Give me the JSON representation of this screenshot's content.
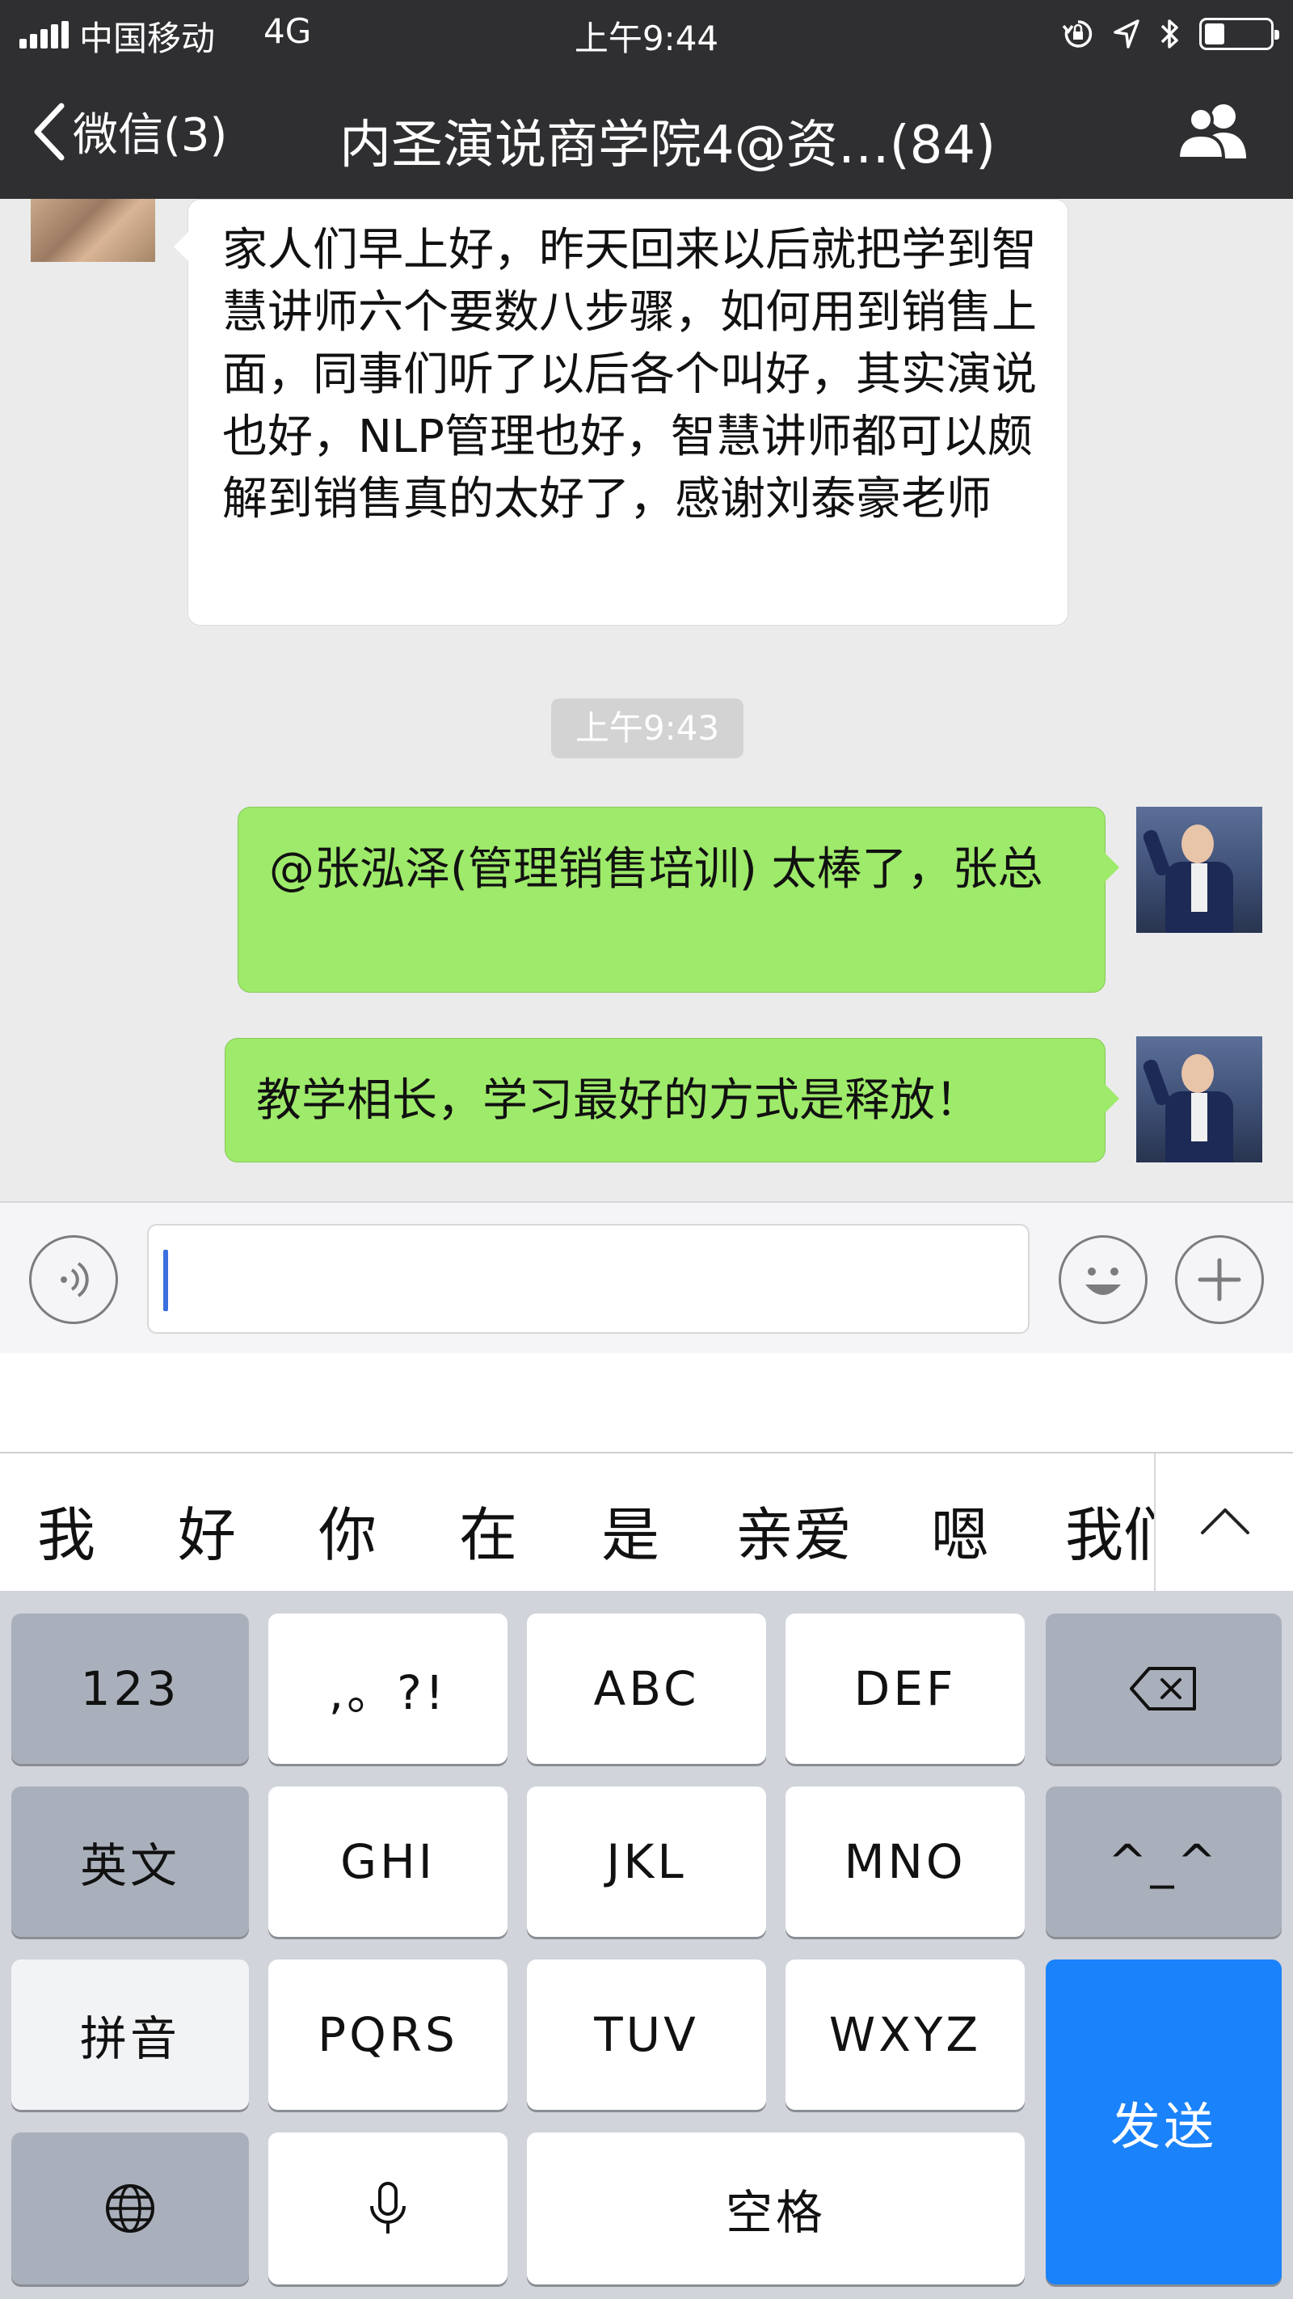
{
  "status_bar": {
    "carrier": "中国移动",
    "network": "4G",
    "time": "上午9:44"
  },
  "nav": {
    "back_label": "微信(3)",
    "title": "内圣演说商学院4@资…(84)"
  },
  "messages": [
    {
      "direction": "incoming",
      "text": "家人们早上好，昨天回来以后就把学到智慧讲师六个要数八步骤，如何用到销售上面，同事们听了以后各个叫好，其实演说也好，NLP管理也好，智慧讲师都可以颇解到销售真的太好了，感谢刘泰豪老师"
    },
    {
      "direction": "timestamp",
      "text": "上午9:43"
    },
    {
      "direction": "outgoing",
      "text": "@张泓泽(管理销售培训) 太棒了，张总"
    },
    {
      "direction": "outgoing",
      "text": "教学相长，学习最好的方式是释放！"
    }
  ],
  "input": {
    "value": ""
  },
  "candidates": [
    "我",
    "好",
    "你",
    "在",
    "是",
    "亲爱",
    "嗯",
    "我们"
  ],
  "keyboard": {
    "row1": [
      "123",
      ",。?!",
      "ABC",
      "DEF"
    ],
    "row2": [
      "英文",
      "GHI",
      "JKL",
      "MNO",
      "^_^"
    ],
    "row3": [
      "拼音",
      "PQRS",
      "TUV",
      "WXYZ"
    ],
    "row4_space": "空格",
    "send": "发送"
  },
  "icons": {
    "back": "chevron-left-icon",
    "members": "group-members-icon",
    "voice": "voice-input-icon",
    "emoji": "emoji-icon",
    "plus": "plus-icon",
    "delete": "backspace-icon",
    "globe": "globe-icon",
    "mic": "microphone-icon",
    "collapse": "chevron-up-icon"
  },
  "colors": {
    "nav_bg": "#2f2f32",
    "outgoing_bubble": "#9eea6a",
    "send_key": "#1a82fb"
  }
}
